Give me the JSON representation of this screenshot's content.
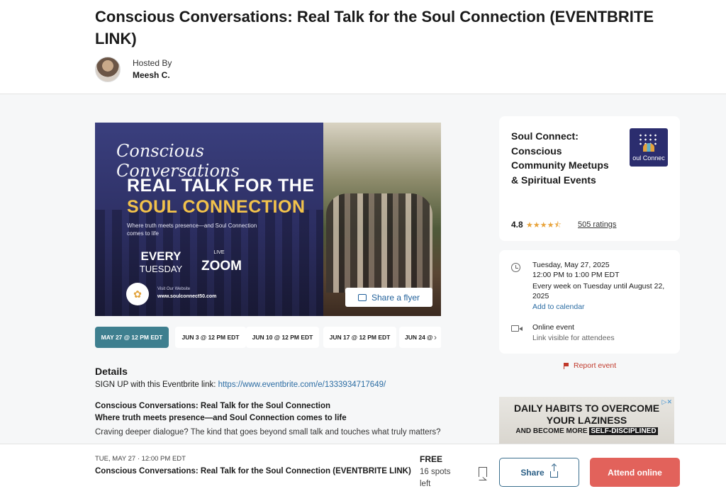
{
  "event": {
    "title": "Conscious Conversations: Real Talk for the Soul Connection (EVENTBRITE LINK)",
    "hosted_by_label": "Hosted By",
    "host_name": "Meesh C."
  },
  "flyer": {
    "script_title": "Conscious Conversations",
    "headline_1": "REAL TALK FOR THE",
    "headline_2": "SOUL CONNECTION",
    "subtitle": "Where truth meets presence—and Soul Connection comes to life",
    "every": "EVERY",
    "tuesday": "TUESDAY",
    "live": "LIVE",
    "zoom": "ZOOM",
    "logo_caption": "Soul Connect",
    "visit_label": "Visit Our Website",
    "website": "www.soulconnect50.com",
    "share_label": "Share a flyer"
  },
  "date_tabs": [
    {
      "label": "MAY 27 @ 12 PM EDT",
      "active": true
    },
    {
      "label": "JUN 3 @ 12 PM EDT",
      "active": false
    },
    {
      "label": "JUN 10 @ 12 PM EDT",
      "active": false
    },
    {
      "label": "JUN 17 @ 12 PM EDT",
      "active": false
    },
    {
      "label": "JUN 24 @",
      "active": false
    }
  ],
  "details": {
    "heading": "Details",
    "signup_text": "SIGN UP with this Eventbrite link: ",
    "signup_link": "https://www.eventbrite.com/e/1333934717649/",
    "bold_line_1": "Conscious Conversations: Real Talk for the Soul Connection",
    "bold_line_2": "Where truth meets presence—and Soul Connection comes to life",
    "body": "Craving deeper dialogue? The kind that goes beyond small talk and touches what truly matters?"
  },
  "organizer": {
    "name": "Soul Connect: Conscious Community Meetups & Spiritual Events",
    "logo_text": "oul Connec",
    "rating": "4.8",
    "stars": "★★★★⯪",
    "ratings_link": "505 ratings"
  },
  "schedule": {
    "date": "Tuesday, May 27, 2025",
    "time": "12:00 PM to 1:00 PM EDT",
    "recurrence_1": "Every week on Tuesday until August 22,",
    "recurrence_2": "2025",
    "add_calendar": "Add to calendar",
    "location_type": "Online event",
    "location_note": "Link visible for attendees"
  },
  "report": {
    "label": "Report event"
  },
  "ad": {
    "line_1": "DAILY HABITS TO OVERCOME",
    "line_2": "YOUR LAZINESS",
    "line_3_prefix": "AND BECOME MORE ",
    "line_3_highlight": "SELF-DISCIPLINED",
    "close": "▷✕"
  },
  "bottom_bar": {
    "date": "TUE, MAY 27 · 12:00 PM EDT",
    "title": "Conscious Conversations: Real Talk for the Soul Connection (EVENTBRITE LINK)",
    "price": "FREE",
    "spots": "16 spots left",
    "share_label": "Share",
    "attend_label": "Attend online"
  },
  "colors": {
    "primary_teal": "#3e7f8f",
    "attend_red": "#e2625b",
    "link_blue": "#2b6ca3",
    "report_red": "#c0392b",
    "star_gold": "#e8a33a"
  }
}
